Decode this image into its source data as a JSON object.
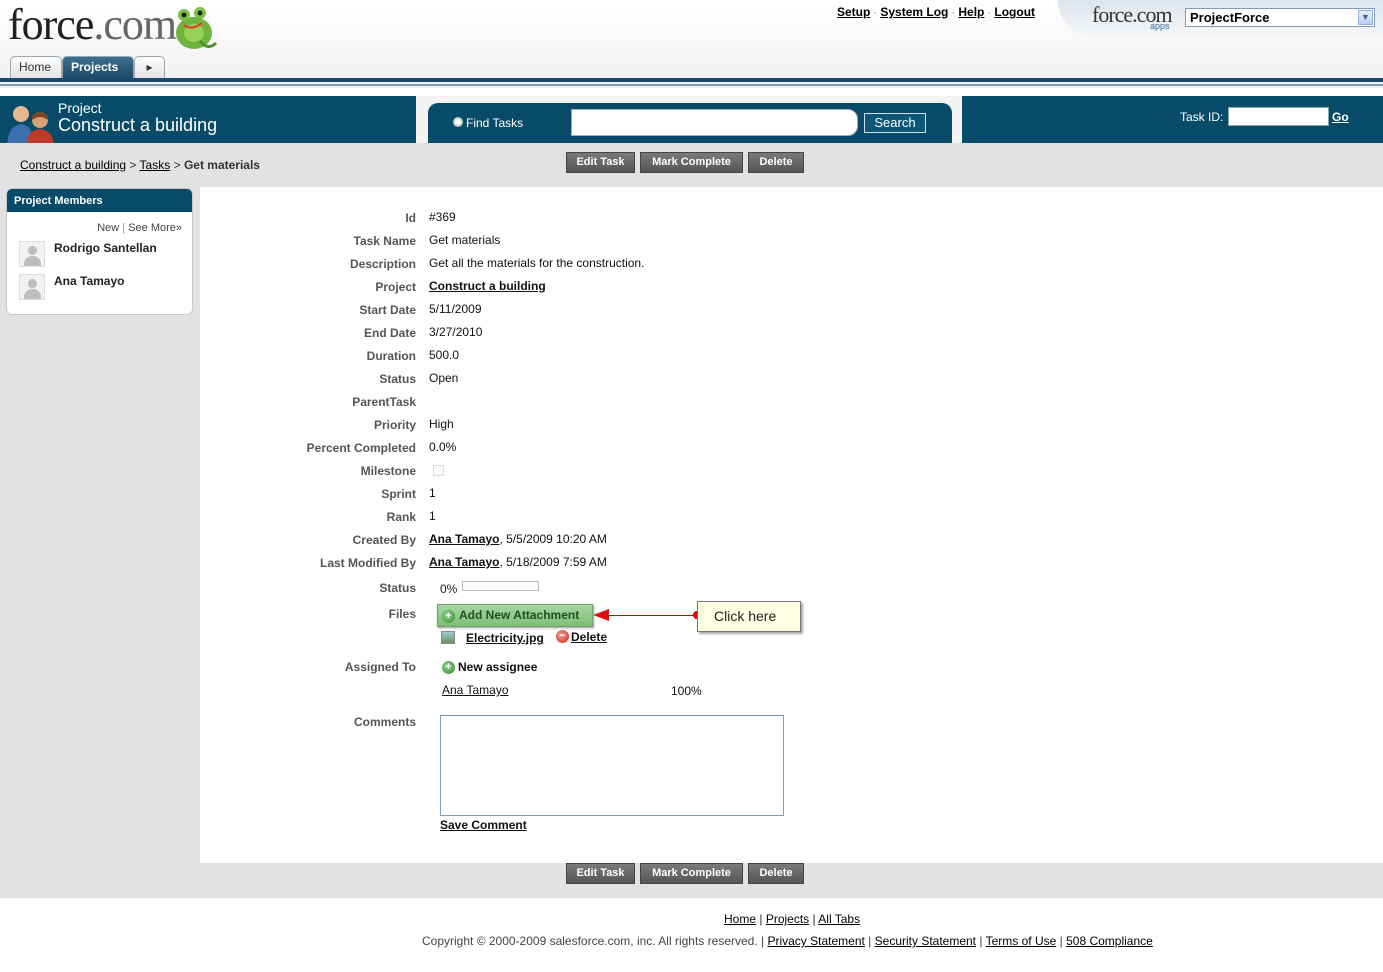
{
  "header": {
    "logo_text": "force",
    "logo_dotcom": ".com",
    "top_links": [
      "Setup",
      "System Log",
      "Help",
      "Logout"
    ],
    "apps_logo": "force.com",
    "apps_sub": "apps",
    "app_selected": "ProjectForce",
    "tabs": [
      "Home",
      "Projects"
    ]
  },
  "project": {
    "label": "Project",
    "name": "Construct a building"
  },
  "search": {
    "find_label": "Find Tasks",
    "value": "",
    "button": "Search",
    "task_id_label": "Task ID:",
    "go_label": "Go"
  },
  "breadcrumb": {
    "project": "Construct a building",
    "sep": ">",
    "tasks": "Tasks",
    "current": "Get materials"
  },
  "actions": {
    "edit": "Edit Task",
    "complete": "Mark Complete",
    "delete": "Delete"
  },
  "members": {
    "title": "Project Members",
    "new_link": "New",
    "see_more": "See More»",
    "list": [
      "Rodrigo Santellan",
      "Ana Tamayo"
    ]
  },
  "task": {
    "labels": {
      "id": "Id",
      "name": "Task Name",
      "description": "Description",
      "project": "Project",
      "start": "Start Date",
      "end": "End Date",
      "duration": "Duration",
      "status": "Status",
      "parent": "ParentTask",
      "priority": "Priority",
      "percent": "Percent Completed",
      "milestone": "Milestone",
      "sprint": "Sprint",
      "rank": "Rank",
      "created": "Created By",
      "modified": "Last Modified By",
      "status2": "Status",
      "files": "Files",
      "assigned": "Assigned To",
      "comments": "Comments"
    },
    "id": "#369",
    "name": "Get materials",
    "description": "Get all the materials for the construction.",
    "project": "Construct a building",
    "start": "5/11/2009",
    "end": "3/27/2010",
    "duration": "500.0",
    "status": "Open",
    "parent": "",
    "priority": "High",
    "percent": "0.0%",
    "milestone": false,
    "sprint": "1",
    "rank": "1",
    "created_by": "Ana Tamayo",
    "created_at": ", 5/5/2009 10:20 AM",
    "modified_by": "Ana Tamayo",
    "modified_at": ", 5/18/2009 7:59 AM",
    "progress_text": "0%",
    "progress_fraction": 0.0,
    "add_attachment": "Add New Attachment",
    "file_name": "Electricity.jpg",
    "file_delete": "Delete",
    "new_assignee": "New assignee",
    "assignee": "Ana Tamayo",
    "assignee_pct": "100%",
    "comment_value": "",
    "save_comment": "Save Comment"
  },
  "callout": {
    "text": "Click here",
    "color": "#cc0000"
  },
  "footer": {
    "links": [
      "Home",
      "Projects",
      "All Tabs"
    ],
    "copyright": "Copyright © 2000-2009 salesforce.com, inc. All rights reserved. |",
    "legal": [
      "Privacy Statement",
      "Security Statement",
      "Terms of Use",
      "508 Compliance"
    ]
  }
}
